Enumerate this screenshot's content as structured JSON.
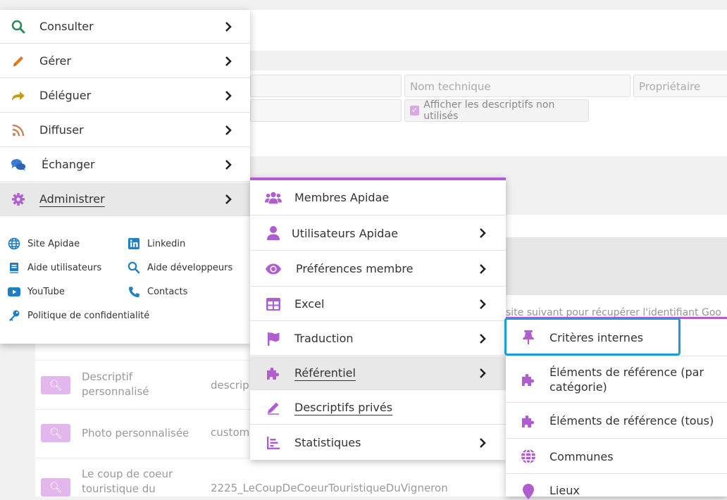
{
  "background": {
    "fields": {
      "nom_technique_placeholder": "Nom technique",
      "proprietaire_placeholder": "Propriétaire",
      "afficher_descriptifs_label": "Afficher les descriptifs non utilisés"
    },
    "help_text": "site suivant pour récupérer l'identifiant Goo",
    "rows": [
      {
        "label": "Descriptif personnalisé",
        "technical": "descrip"
      },
      {
        "label": "Photo personnalisée",
        "technical": "custom"
      },
      {
        "label": "Le coup de coeur touristique du",
        "technical": "2225_LeCoupDeCoeurTouristiqueDuVigneron"
      }
    ]
  },
  "main_menu": {
    "items": [
      {
        "label": "Consulter",
        "icon": "search-icon",
        "color": "#2e8b57"
      },
      {
        "label": "Gérer",
        "icon": "pencil-icon",
        "color": "#e07b24"
      },
      {
        "label": "Déléguer",
        "icon": "share-arrow-icon",
        "color": "#c49a1a"
      },
      {
        "label": "Diffuser",
        "icon": "rss-icon",
        "color": "#c9865a"
      },
      {
        "label": "Échanger",
        "icon": "chat-bubbles-icon",
        "color": "#3a7bd5"
      },
      {
        "label": "Administrer",
        "icon": "gear-icon",
        "color": "#b05dd0"
      }
    ],
    "links": [
      {
        "label": "Site Apidae",
        "icon": "globe-icon"
      },
      {
        "label": "Linkedin",
        "icon": "linkedin-icon"
      },
      {
        "label": "Aide utilisateurs",
        "icon": "book-icon"
      },
      {
        "label": "Aide développeurs",
        "icon": "search-icon"
      },
      {
        "label": "YouTube",
        "icon": "youtube-icon"
      },
      {
        "label": "Contacts",
        "icon": "phone-icon"
      },
      {
        "label": "Politique de confidentialité",
        "icon": "key-icon"
      }
    ],
    "link_color": "#1e7fc4"
  },
  "admin_submenu": {
    "accent": "#b05dd0",
    "items": [
      {
        "label": "Membres Apidae",
        "icon": "users-icon",
        "has_submenu": false
      },
      {
        "label": "Utilisateurs Apidae",
        "icon": "user-icon",
        "has_submenu": true
      },
      {
        "label": "Préférences membre",
        "icon": "eye-icon",
        "has_submenu": true
      },
      {
        "label": "Excel",
        "icon": "table-icon",
        "has_submenu": true
      },
      {
        "label": "Traduction",
        "icon": "flag-icon",
        "has_submenu": true
      },
      {
        "label": "Référentiel",
        "icon": "puzzle-icon",
        "has_submenu": true
      },
      {
        "label": "Descriptifs privés",
        "icon": "pencil-icon",
        "has_submenu": false
      },
      {
        "label": "Statistiques",
        "icon": "bar-chart-icon",
        "has_submenu": true
      }
    ]
  },
  "referentiel_submenu": {
    "items": [
      {
        "label": "Critères internes",
        "icon": "pin-icon"
      },
      {
        "label": "Éléments de référence (par catégorie)",
        "icon": "puzzle-icon"
      },
      {
        "label": "Éléments de référence (tous)",
        "icon": "puzzle-icon"
      },
      {
        "label": "Communes",
        "icon": "globe-icon"
      },
      {
        "label": "Lieux",
        "icon": "map-marker-icon"
      }
    ]
  }
}
